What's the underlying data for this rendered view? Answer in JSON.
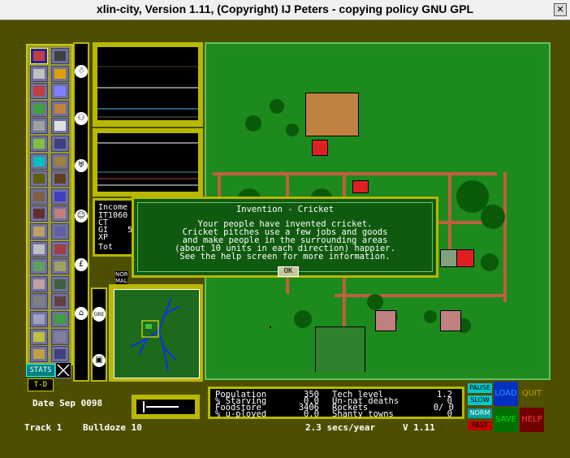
{
  "window": {
    "title": "xlin-city, Version 1.11, (Copyright) IJ Peters - copying policy GNU GPL"
  },
  "colors": {
    "frame": "#b8b800",
    "background": "#4e4e00",
    "grass": "#1d8a1d",
    "road": "#c06040",
    "dialog": "#0f5a0f"
  },
  "toolbar": {
    "buttons": [
      "residential",
      "transport",
      "power",
      "market",
      "commerce",
      "university",
      "health",
      "fire",
      "farm",
      "rail",
      "school",
      "park",
      "tip",
      "recycle",
      "tree",
      "substation",
      "road",
      "water",
      "bulldoze",
      "query",
      "wind",
      "coal",
      "industry-light",
      "industry-heavy",
      "organic",
      "mine",
      "port",
      "rocket",
      "pottery",
      "blacksmith",
      "mill",
      "monument",
      "windmill",
      "sports",
      "shanty",
      "help"
    ],
    "stats_label": "STATS",
    "toggle_label": "T-D"
  },
  "side_icons": [
    "people-icon",
    "sport-icon",
    "food-icon",
    "worker-icon",
    "money-icon",
    "house-icon",
    "ore-icon",
    "goods-icon"
  ],
  "side_labels": {
    "ore": "ORE"
  },
  "finance": {
    "income_label": "Income",
    "line1": "IT1060",
    "line2": "CT",
    "line3": "GI    5",
    "line4": "XP",
    "total": "Tot"
  },
  "mini_mode": {
    "nor": "NOR",
    "mal": "MAL"
  },
  "dialog": {
    "title": "Invention - Cricket",
    "lines": [
      "Your people have invented cricket.",
      "Cricket pitches use a few jobs and goods",
      "and make people in the surrounding areas",
      "(about 10 units in each direction) happier.",
      "See the help screen for more information."
    ],
    "ok_label": "OK"
  },
  "stats": {
    "population_label": "Population",
    "population": "350",
    "starving_label": "% Starving",
    "starving": "0.0",
    "foodstore_label": "Foodstore",
    "foodstore": "3406",
    "unemployed_label": "% u-ployed",
    "unemployed": "0.0",
    "tech_label": "Tech level",
    "tech": "1.2",
    "deaths_label": "Un-nat deaths",
    "deaths": "0",
    "rockets_label": "Rockets",
    "rockets": "0/  0",
    "shanty_label": "Shanty towns",
    "shanty": "0"
  },
  "status": {
    "date": "Date Sep 0098",
    "track": "Track 1",
    "tool": "Bulldoze 10",
    "speed": "2.3 secs/year",
    "version": "V 1.11"
  },
  "controls": {
    "pause": "PAUSE",
    "slow": "SLOW",
    "norm": "NORM",
    "fast": "FAST",
    "load": "LOAD",
    "quit": "QUIT",
    "save": "SAVE",
    "help": "HELP"
  }
}
